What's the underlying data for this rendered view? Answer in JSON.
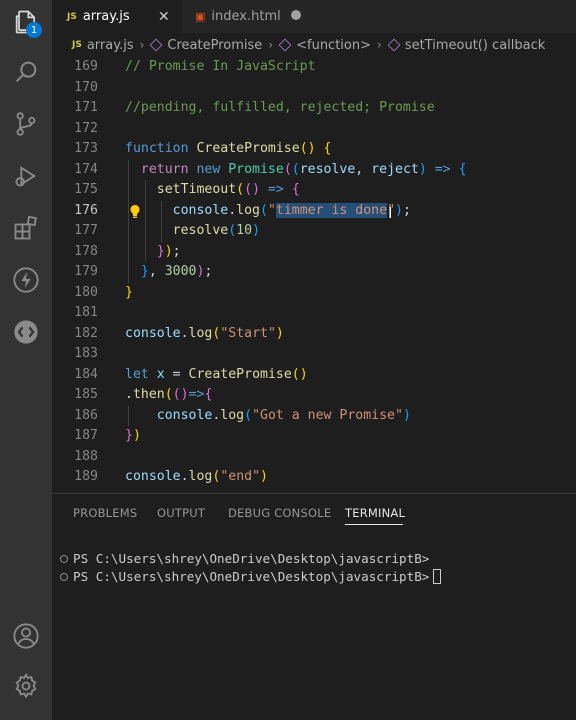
{
  "tabs": [
    {
      "icon": "JS",
      "label": "array.js",
      "active": true
    },
    {
      "icon": "5",
      "label": "index.html",
      "active": false,
      "modified": true
    }
  ],
  "breadcrumb": [
    "array.js",
    "CreatePromise",
    "<function>",
    "setTimeout() callback"
  ],
  "activity": {
    "badge": "1"
  },
  "editor": {
    "lines": [
      {
        "n": "169",
        "tokens": [
          [
            "c-comment",
            "// Promise In JavaScript"
          ]
        ]
      },
      {
        "n": "170",
        "tokens": []
      },
      {
        "n": "171",
        "tokens": [
          [
            "c-comment",
            "//pending, fulfilled, rejected; Promise"
          ]
        ]
      },
      {
        "n": "172",
        "tokens": []
      },
      {
        "n": "173",
        "tokens": [
          [
            "c-kw",
            "function "
          ],
          [
            "c-fn",
            "CreatePromise"
          ],
          [
            "c-b1",
            "()"
          ],
          [
            "c-pun",
            " "
          ],
          [
            "c-b1",
            "{"
          ]
        ]
      },
      {
        "n": "174",
        "tokens": [
          [
            "c-pun",
            "  "
          ],
          [
            "c-ctrl",
            "return "
          ],
          [
            "c-kw",
            "new "
          ],
          [
            "c-cls",
            "Promise"
          ],
          [
            "c-b2",
            "("
          ],
          [
            "c-b3",
            "("
          ],
          [
            "c-var",
            "resolve"
          ],
          [
            "c-pun",
            ", "
          ],
          [
            "c-var",
            "reject"
          ],
          [
            "c-b3",
            ")"
          ],
          [
            "c-pun",
            " "
          ],
          [
            "c-kw",
            "=>"
          ],
          [
            "c-pun",
            " "
          ],
          [
            "c-b3",
            "{"
          ]
        ]
      },
      {
        "n": "175",
        "tokens": [
          [
            "c-pun",
            "    "
          ],
          [
            "c-fn",
            "setTimeout"
          ],
          [
            "c-b1",
            "("
          ],
          [
            "c-b2",
            "()"
          ],
          [
            "c-pun",
            " "
          ],
          [
            "c-kw",
            "=>"
          ],
          [
            "c-pun",
            " "
          ],
          [
            "c-b2",
            "{"
          ]
        ]
      },
      {
        "n": "176",
        "tokens": [
          [
            "c-pun",
            "      "
          ],
          [
            "c-var",
            "console"
          ],
          [
            "c-pun",
            "."
          ],
          [
            "c-fn",
            "log"
          ],
          [
            "c-b3",
            "("
          ],
          [
            "c-str",
            "\""
          ],
          [
            "c-str sel",
            "timmer is done"
          ],
          [
            "c-str",
            "\""
          ],
          [
            "c-b3",
            ")"
          ],
          [
            "c-pun",
            ";"
          ]
        ]
      },
      {
        "n": "177",
        "tokens": [
          [
            "c-pun",
            "      "
          ],
          [
            "c-fn",
            "resolve"
          ],
          [
            "c-b3",
            "("
          ],
          [
            "c-num",
            "10"
          ],
          [
            "c-b3",
            ")"
          ]
        ]
      },
      {
        "n": "178",
        "tokens": [
          [
            "c-pun",
            "    "
          ],
          [
            "c-b2",
            "}"
          ],
          [
            "c-b1",
            ")"
          ],
          [
            "c-pun",
            ";"
          ]
        ]
      },
      {
        "n": "179",
        "tokens": [
          [
            "c-pun",
            "  "
          ],
          [
            "c-b3",
            "}"
          ],
          [
            "c-pun",
            ", "
          ],
          [
            "c-num",
            "3000"
          ],
          [
            "c-b2",
            ")"
          ],
          [
            "c-pun",
            ";"
          ]
        ]
      },
      {
        "n": "180",
        "tokens": [
          [
            "c-b1",
            "}"
          ]
        ]
      },
      {
        "n": "181",
        "tokens": []
      },
      {
        "n": "182",
        "tokens": [
          [
            "c-var",
            "console"
          ],
          [
            "c-pun",
            "."
          ],
          [
            "c-fn",
            "log"
          ],
          [
            "c-b1",
            "("
          ],
          [
            "c-str",
            "\"Start\""
          ],
          [
            "c-b1",
            ")"
          ]
        ]
      },
      {
        "n": "183",
        "tokens": []
      },
      {
        "n": "184",
        "tokens": [
          [
            "c-kw",
            "let "
          ],
          [
            "c-var",
            "x"
          ],
          [
            "c-pun",
            " = "
          ],
          [
            "c-fn",
            "CreatePromise"
          ],
          [
            "c-b1",
            "()"
          ]
        ]
      },
      {
        "n": "185",
        "tokens": [
          [
            "c-pun",
            "."
          ],
          [
            "c-fn",
            "then"
          ],
          [
            "c-b1",
            "("
          ],
          [
            "c-b2",
            "()"
          ],
          [
            "c-kw",
            "=>"
          ],
          [
            "c-b2",
            "{"
          ]
        ]
      },
      {
        "n": "186",
        "tokens": [
          [
            "c-pun",
            "    "
          ],
          [
            "c-var",
            "console"
          ],
          [
            "c-pun",
            "."
          ],
          [
            "c-fn",
            "log"
          ],
          [
            "c-b3",
            "("
          ],
          [
            "c-str",
            "\"Got a new Promise\""
          ],
          [
            "c-b3",
            ")"
          ]
        ]
      },
      {
        "n": "187",
        "tokens": [
          [
            "c-b2",
            "}"
          ],
          [
            "c-b1",
            ")"
          ]
        ]
      },
      {
        "n": "188",
        "tokens": []
      },
      {
        "n": "189",
        "tokens": [
          [
            "c-var",
            "console"
          ],
          [
            "c-pun",
            "."
          ],
          [
            "c-fn",
            "log"
          ],
          [
            "c-b1",
            "("
          ],
          [
            "c-str",
            "\"end\""
          ],
          [
            "c-b1",
            ")"
          ]
        ]
      }
    ],
    "current_line": "176"
  },
  "panel": {
    "tabs": [
      "PROBLEMS",
      "OUTPUT",
      "DEBUG CONSOLE",
      "TERMINAL"
    ],
    "active_tab": "TERMINAL",
    "terminal_lines": [
      "PS C:\\Users\\shrey\\OneDrive\\Desktop\\javascriptB>",
      "PS C:\\Users\\shrey\\OneDrive\\Desktop\\javascriptB>"
    ]
  },
  "colors": {
    "js_icon": "#cbcb41",
    "html_icon": "#e44d26",
    "accent": "#0078d4",
    "bulb": "#ffcc00"
  }
}
